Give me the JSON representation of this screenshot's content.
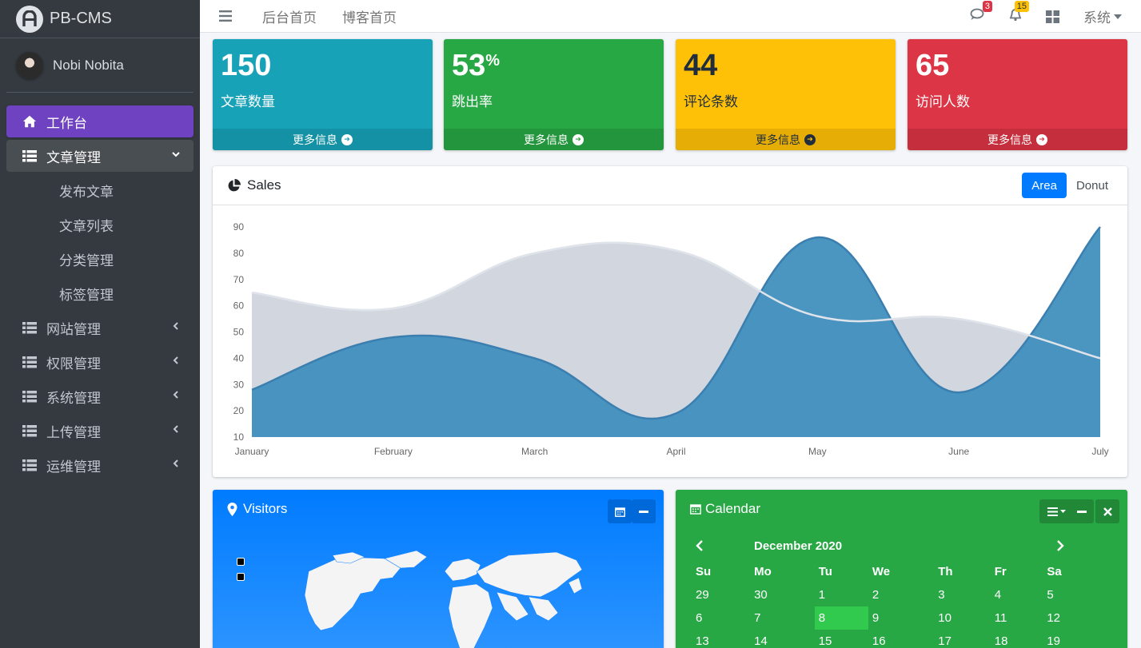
{
  "brand": {
    "name": "PB-CMS"
  },
  "user": {
    "name": "Nobi Nobita"
  },
  "sidebar": {
    "items": [
      {
        "label": "工作台",
        "icon": "home-icon",
        "active": true
      },
      {
        "label": "文章管理",
        "icon": "list-icon",
        "open": true,
        "children": [
          {
            "label": "发布文章"
          },
          {
            "label": "文章列表"
          },
          {
            "label": "分类管理"
          },
          {
            "label": "标签管理"
          }
        ]
      },
      {
        "label": "网站管理",
        "icon": "list-icon"
      },
      {
        "label": "权限管理",
        "icon": "list-icon"
      },
      {
        "label": "系统管理",
        "icon": "list-icon"
      },
      {
        "label": "上传管理",
        "icon": "list-icon"
      },
      {
        "label": "运维管理",
        "icon": "list-icon"
      }
    ]
  },
  "navbar": {
    "links": [
      {
        "label": "后台首页"
      },
      {
        "label": "博客首页"
      }
    ],
    "messages_count": "3",
    "notifications_count": "15",
    "system_label": "系统"
  },
  "stats": [
    {
      "value": "150",
      "suffix": "",
      "label": "文章数量",
      "more": "更多信息",
      "color": "#17a2b8"
    },
    {
      "value": "53",
      "suffix": "%",
      "label": "跳出率",
      "more": "更多信息",
      "color": "#28a745"
    },
    {
      "value": "44",
      "suffix": "",
      "label": "评论条数",
      "more": "更多信息",
      "color": "#ffc107"
    },
    {
      "value": "65",
      "suffix": "",
      "label": "访问人数",
      "more": "更多信息",
      "color": "#dc3545"
    }
  ],
  "sales": {
    "title": "Sales",
    "tabs": [
      {
        "label": "Area"
      },
      {
        "label": "Donut"
      }
    ]
  },
  "chart_data": {
    "type": "area",
    "categories": [
      "January",
      "February",
      "March",
      "April",
      "May",
      "June",
      "July"
    ],
    "ylim": [
      10,
      90
    ],
    "yticks": [
      10,
      20,
      30,
      40,
      50,
      60,
      70,
      80,
      90
    ],
    "series": [
      {
        "values": [
          65,
          59,
          80,
          81,
          56,
          55,
          40
        ],
        "color": "#d2d6de"
      },
      {
        "values": [
          28,
          48,
          40,
          19,
          86,
          27,
          90
        ],
        "color": "#3c8dbc"
      }
    ]
  },
  "visitors": {
    "title": "Visitors"
  },
  "calendar": {
    "title": "Calendar",
    "month": "December 2020",
    "weekdays": [
      "Su",
      "Mo",
      "Tu",
      "We",
      "Th",
      "Fr",
      "Sa"
    ],
    "weeks": [
      [
        "29",
        "30",
        "1",
        "2",
        "3",
        "4",
        "5"
      ],
      [
        "6",
        "7",
        "8",
        "9",
        "10",
        "11",
        "12"
      ],
      [
        "13",
        "14",
        "15",
        "16",
        "17",
        "18",
        "19"
      ]
    ],
    "today": "8"
  }
}
